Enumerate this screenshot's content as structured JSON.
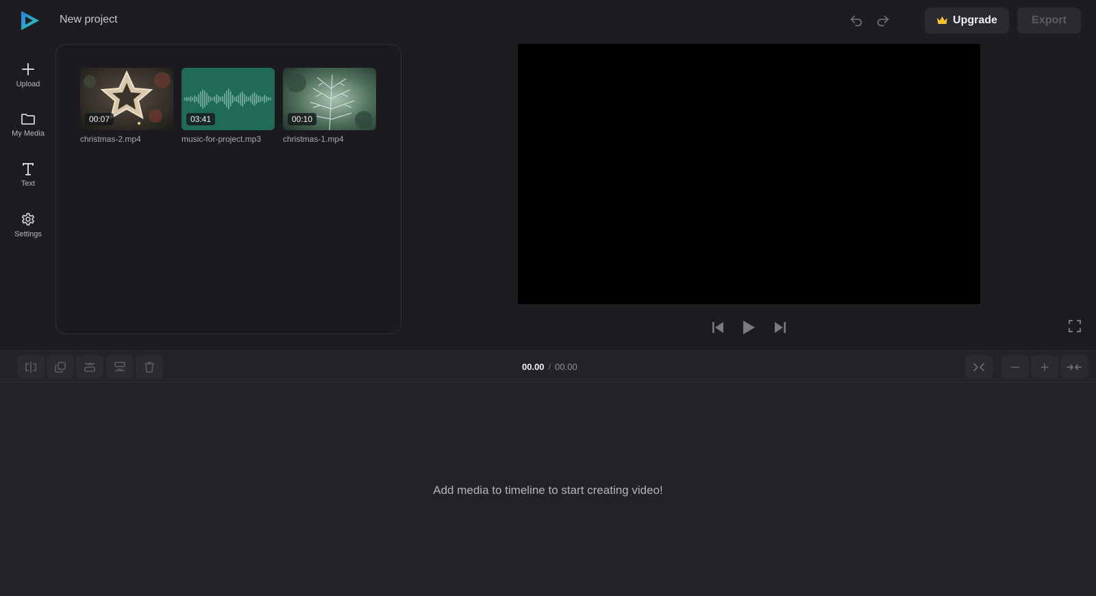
{
  "header": {
    "project_title": "New project",
    "upgrade_label": "Upgrade",
    "export_label": "Export"
  },
  "sidebar": {
    "items": [
      {
        "label": "Upload",
        "icon": "plus-icon"
      },
      {
        "label": "My Media",
        "icon": "folder-icon"
      },
      {
        "label": "Text",
        "icon": "text-icon"
      },
      {
        "label": "Settings",
        "icon": "gear-icon"
      }
    ]
  },
  "media": {
    "items": [
      {
        "filename": "christmas-2.mp4",
        "duration": "00:07",
        "kind": "video"
      },
      {
        "filename": "music-for-project.mp3",
        "duration": "03:41",
        "kind": "audio"
      },
      {
        "filename": "christmas-1.mp4",
        "duration": "00:10",
        "kind": "video"
      }
    ]
  },
  "timeline": {
    "current_time": "00.00",
    "separator": "/",
    "total_time": "00.00",
    "empty_message": "Add media to timeline to start creating video!"
  },
  "colors": {
    "background": "#1c1c21",
    "audio_thumb": "#1f6b58",
    "logo_blue": "#2a7be4",
    "logo_green": "#2fd3a6",
    "crown": "#f2c230"
  }
}
